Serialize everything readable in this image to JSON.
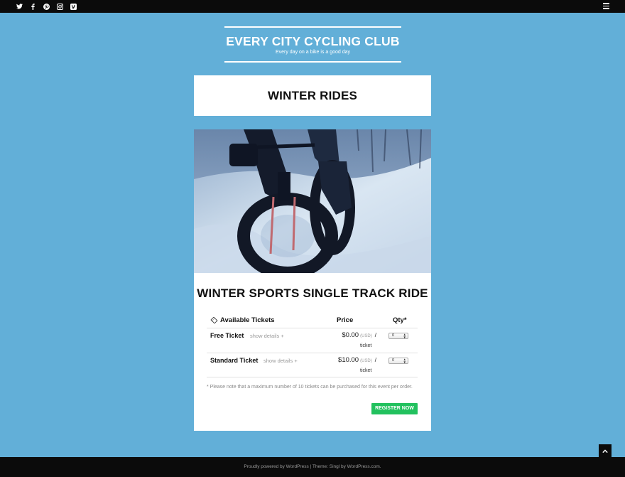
{
  "topbar": {
    "social_icons": [
      "twitter-icon",
      "facebook-icon",
      "pinterest-icon",
      "instagram-icon",
      "vine-icon"
    ],
    "menu_icon": "hamburger-menu-icon"
  },
  "site": {
    "title": "EVERY CITY CYCLING CLUB",
    "tagline": "Every day on a bike is a good day"
  },
  "page": {
    "title": "WINTER RIDES"
  },
  "event": {
    "title": "WINTER SPORTS SINGLE TRACK RIDE",
    "tickets_header": {
      "name": "Available Tickets",
      "price": "Price",
      "qty": "Qty*"
    },
    "tickets": [
      {
        "name": "Free Ticket",
        "details": "show details +",
        "price": "$0.00",
        "currency": "(USD)",
        "slash": "/",
        "per": "ticket",
        "qty": "0"
      },
      {
        "name": "Standard Ticket",
        "details": "show details +",
        "price": "$10.00",
        "currency": "(USD)",
        "slash": "/",
        "per": "ticket",
        "qty": "0"
      }
    ],
    "note": "* Please note that a maximum number of 10 tickets can be purchased for this event per order.",
    "register_label": "REGISTER NOW"
  },
  "footer": {
    "text": "Proudly powered by WordPress | Theme: Singl by WordPress.com."
  },
  "colors": {
    "background": "#62afd8",
    "bar": "#0b0b0b",
    "register": "#22c15e"
  }
}
